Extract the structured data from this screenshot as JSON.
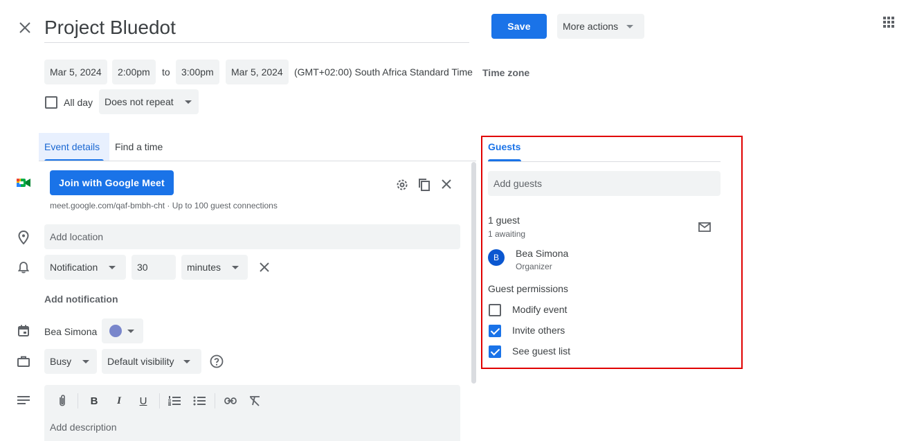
{
  "title": "Project Bluedot",
  "header": {
    "save_label": "Save",
    "more_actions_label": "More actions"
  },
  "datetime": {
    "start_date": "Mar 5, 2024",
    "start_time": "2:00pm",
    "to_label": "to",
    "end_time": "3:00pm",
    "end_date": "Mar 5, 2024",
    "timezone_text": "(GMT+02:00) South Africa Standard Time",
    "timezone_button": "Time zone"
  },
  "options": {
    "all_day_label": "All day",
    "all_day_checked": false,
    "repeat_value": "Does not repeat"
  },
  "tabs": [
    {
      "label": "Event details",
      "active": true
    },
    {
      "label": "Find a time",
      "active": false
    }
  ],
  "meet": {
    "join_label": "Join with Google Meet",
    "info": "meet.google.com/qaf-bmbh-cht · Up to 100 guest connections"
  },
  "location": {
    "placeholder": "Add location"
  },
  "notification": {
    "type": "Notification",
    "amount": "30",
    "unit": "minutes",
    "add_label": "Add notification"
  },
  "calendar": {
    "owner": "Bea Simona",
    "color": "#7986cb"
  },
  "availability": {
    "busy": "Busy",
    "visibility": "Default visibility"
  },
  "description": {
    "placeholder": "Add description"
  },
  "guests_panel": {
    "tab_label": "Guests",
    "add_placeholder": "Add guests",
    "count_label": "1 guest",
    "awaiting_label": "1 awaiting",
    "guests": [
      {
        "initial": "B",
        "name": "Bea Simona",
        "role": "Organizer",
        "avatar_color": "#0b57d0"
      }
    ],
    "permissions_title": "Guest permissions",
    "permissions": [
      {
        "label": "Modify event",
        "checked": false
      },
      {
        "label": "Invite others",
        "checked": true
      },
      {
        "label": "See guest list",
        "checked": true
      }
    ]
  },
  "colors": {
    "accent": "#1a73e8",
    "highlight_border": "#e00000",
    "field_bg": "#f1f3f4"
  }
}
